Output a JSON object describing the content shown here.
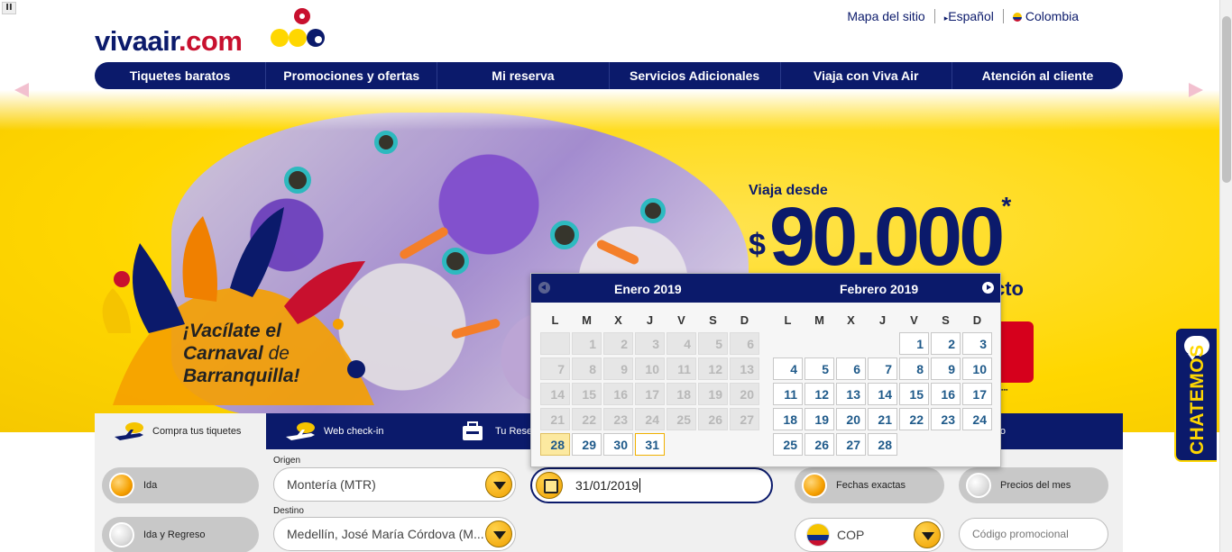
{
  "brand": {
    "logo_main": "vivaair",
    "logo_suffix": ".com"
  },
  "toplinks": {
    "sitemap": "Mapa del sitio",
    "language": "Español",
    "country": "Colombia"
  },
  "nav": [
    {
      "label": "Tiquetes baratos"
    },
    {
      "label": "Promociones y ofertas"
    },
    {
      "label": "Mi reserva"
    },
    {
      "label": "Servicios Adicionales"
    },
    {
      "label": "Viaja con Viva Air"
    },
    {
      "label": "Atención al cliente"
    }
  ],
  "hero": {
    "headline_line1": "¡Vacílate el",
    "headline_carnaval": "Carnaval",
    "headline_de": "de",
    "headline_line3": "Barranquilla!",
    "promo_from": "Viaja desde",
    "promo_currency": "$",
    "promo_amount": "90.000",
    "promo_star": "*",
    "promo_tail": "cto"
  },
  "chat": {
    "label": "CHATEMOS"
  },
  "booking": {
    "tabs": [
      {
        "label": "Compra tus tiquetes",
        "icon": "plane-icon"
      },
      {
        "label": "Web check-in",
        "icon": "plane-icon"
      },
      {
        "label": "Tu Reser",
        "icon": "luggage-icon"
      },
      {
        "label": "Carro",
        "icon": "car-icon"
      }
    ],
    "trip_one_way": "Ida",
    "trip_round": "Ida y Regreso",
    "origin_label": "Origen",
    "origin_value": "Montería (MTR)",
    "destination_label": "Destino",
    "destination_value": "Medellín, José María Córdova (M...",
    "date_value": "31/01/2019",
    "exact_dates": "Fechas exactas",
    "month_prices": "Precios del mes",
    "currency": "COP",
    "promo_code_placeholder": "Código promocional"
  },
  "calendar": {
    "days_of_week": [
      "L",
      "M",
      "X",
      "J",
      "V",
      "S",
      "D"
    ],
    "months": [
      {
        "title": "Enero 2019",
        "leading_blanks": 1,
        "days": 31,
        "disabled_through": 27,
        "today": 28,
        "selected": 31
      },
      {
        "title": "Febrero 2019",
        "leading_blanks": 4,
        "days": 28,
        "disabled_through": 0,
        "today": null,
        "selected": null
      }
    ]
  },
  "colors": {
    "navy": "#0b1a6b",
    "yellow": "#ffd700",
    "red": "#c8102e",
    "orange": "#f0a000"
  }
}
